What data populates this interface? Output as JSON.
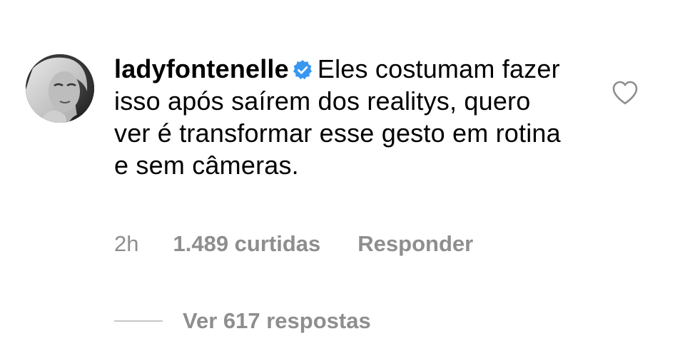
{
  "comment": {
    "username": "ladyfontenelle",
    "verified": true,
    "text": "Eles costumam fazer isso após saírem dos realitys, quero ver é transformar esse gesto em rotina e sem câmeras.",
    "time": "2h",
    "likes_label": "1.489 curtidas",
    "reply_label": "Responder",
    "view_replies_label": "Ver 617 respostas"
  },
  "icons": {
    "avatar": "avatar-photo",
    "verified": "verified-badge-icon",
    "like": "heart-outline-icon"
  },
  "colors": {
    "text": "#000000",
    "meta_text": "#8e8e8e",
    "verified_badge": "#3897f0",
    "background": "#ffffff",
    "divider": "#c7c7c7"
  }
}
